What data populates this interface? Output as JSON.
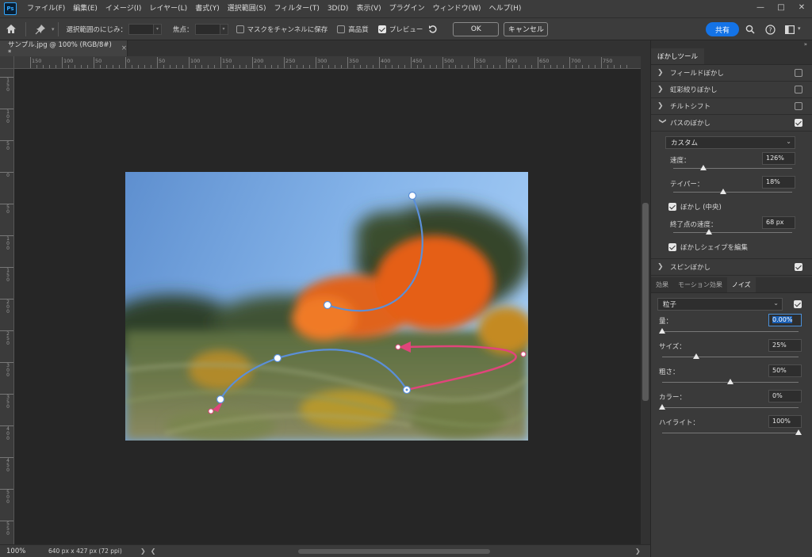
{
  "app": {
    "logo": "Ps"
  },
  "menu": [
    "ファイル(F)",
    "編集(E)",
    "イメージ(I)",
    "レイヤー(L)",
    "書式(Y)",
    "選択範囲(S)",
    "フィルター(T)",
    "3D(D)",
    "表示(V)",
    "プラグイン",
    "ウィンドウ(W)",
    "ヘルプ(H)"
  ],
  "options": {
    "feather_label": "選択範囲のにじみ：",
    "focus_label": "焦点：",
    "save_mask_label": "マスクをチャンネルに保存",
    "high_quality_label": "高品質",
    "preview_label": "プレビュー",
    "ok_label": "OK",
    "cancel_label": "キャンセル",
    "share_label": "共有"
  },
  "document": {
    "tab_title": "サンプル.jpg @ 100% (RGB/8#) *",
    "zoom": "100%",
    "info": "640 px x 427 px (72 ppi)",
    "ruler_h": [
      "150",
      "100",
      "50",
      "0",
      "50",
      "100",
      "150",
      "200",
      "250",
      "300",
      "350",
      "400",
      "450",
      "500",
      "550",
      "600",
      "650",
      "700",
      "750"
    ],
    "ruler_v": [
      "1 5 0",
      "1 0 0",
      "5 0",
      "0",
      "5 0",
      "1 0 0",
      "1 5 0",
      "2 0 0",
      "2 5 0",
      "3 0 0",
      "3 5 0",
      "4 0 0",
      "4 5 0",
      "5 0 0",
      "5 5 0"
    ]
  },
  "panel": {
    "title": "ぼかしツール",
    "blur_types": [
      {
        "label": "フィールドぼかし",
        "checked": false
      },
      {
        "label": "虹彩絞りぼかし",
        "checked": false
      },
      {
        "label": "チルトシフト",
        "checked": false
      },
      {
        "label": "パスのぼかし",
        "checked": true
      }
    ],
    "path_blur": {
      "preset": "カスタム",
      "speed_label": "速度：",
      "speed_value": "126%",
      "speed_level": 0.25,
      "taper_label": "テイパー：",
      "taper_value": "18%",
      "taper_level": 0.42,
      "center_blur_label": "ぼかし (中央)",
      "end_speed_label": "終了点の速度：",
      "end_speed_value": "68 px",
      "end_speed_level": 0.3,
      "edit_shape_label": "ぼかしシェイプを編集"
    },
    "spin_blur": {
      "label": "スピンぼかし",
      "checked": true
    },
    "sub_tabs": [
      "効果",
      "モーション効果",
      "ノイズ"
    ],
    "noise": {
      "type": "粒子",
      "amount_label": "量：",
      "amount_value": "0.00%",
      "amount_level": 0,
      "size_label": "サイズ：",
      "size_value": "25%",
      "size_level": 0.25,
      "roughness_label": "粗さ：",
      "roughness_value": "50%",
      "roughness_level": 0.5,
      "color_label": "カラー：",
      "color_value": "0%",
      "color_level": 0,
      "highlight_label": "ハイライト：",
      "highlight_value": "100%",
      "highlight_level": 1
    }
  },
  "colors": {
    "accent": "#1473e6",
    "path_blue": "#5b8fd8",
    "path_pink": "#e0457b"
  }
}
